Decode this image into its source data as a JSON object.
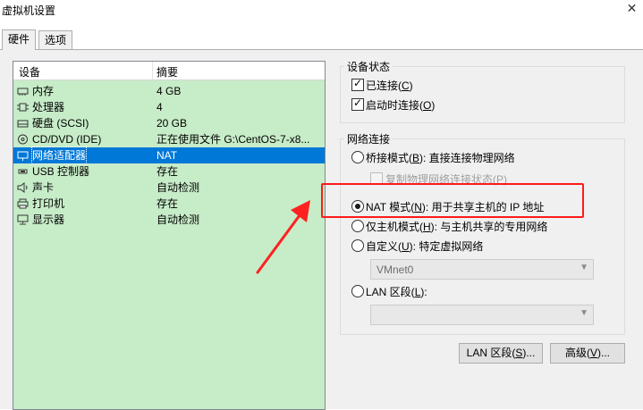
{
  "window": {
    "title": "虚拟机设置",
    "close_glyph": "✕"
  },
  "tabs": [
    {
      "label": "硬件"
    },
    {
      "label": "选项"
    }
  ],
  "device_list": {
    "headers": {
      "device": "设备",
      "summary": "摘要"
    },
    "rows": [
      {
        "device": "内存",
        "summary": "4 GB",
        "icon": "memory-icon"
      },
      {
        "device": "处理器",
        "summary": "4",
        "icon": "processor-icon"
      },
      {
        "device": "硬盘 (SCSI)",
        "summary": "20 GB",
        "icon": "hard-disk-icon"
      },
      {
        "device": "CD/DVD (IDE)",
        "summary": "正在使用文件 G:\\CentOS-7-x8...",
        "icon": "cd-dvd-icon"
      },
      {
        "device": "网络适配器",
        "summary": "NAT",
        "icon": "network-adapter-icon",
        "selected": true
      },
      {
        "device": "USB 控制器",
        "summary": "存在",
        "icon": "usb-icon"
      },
      {
        "device": "声卡",
        "summary": "自动检测",
        "icon": "sound-card-icon"
      },
      {
        "device": "打印机",
        "summary": "存在",
        "icon": "printer-icon"
      },
      {
        "device": "显示器",
        "summary": "自动检测",
        "icon": "display-icon"
      }
    ]
  },
  "device_status": {
    "title": "设备状态",
    "connected": {
      "text": "已连接(",
      "key": "C",
      "tail": ")",
      "checked": true
    },
    "connect_at_power_on": {
      "text": "启动时连接(",
      "key": "O",
      "tail": ")",
      "checked": true
    }
  },
  "network_connection": {
    "title": "网络连接",
    "bridged": {
      "text": "桥接模式(",
      "key": "B",
      "tail": "): 直接连接物理网络",
      "selected": false
    },
    "replicate": {
      "text": "复制物理网络连接状态(",
      "key": "P",
      "tail": ")",
      "checked": false,
      "disabled": true
    },
    "nat": {
      "text": "NAT 模式(",
      "key": "N",
      "tail": "): 用于共享主机的 IP 地址",
      "selected": true
    },
    "host_only": {
      "text": "仅主机模式(",
      "key": "H",
      "tail": "): 与主机共享的专用网络",
      "selected": false
    },
    "custom": {
      "text": "自定义(",
      "key": "U",
      "tail": "): 特定虚拟网络",
      "selected": false
    },
    "custom_combo": {
      "value": "VMnet0"
    },
    "lan_segment": {
      "text": "LAN 区段(",
      "key": "L",
      "tail": "):",
      "selected": false
    },
    "lan_combo": {
      "value": ""
    }
  },
  "buttons": {
    "lan_segments": {
      "text": "LAN 区段(",
      "key": "S",
      "tail": ")..."
    },
    "advanced": {
      "text": "高级(",
      "key": "V",
      "tail": ")..."
    }
  },
  "annotation": {
    "color": "#ff2020"
  }
}
